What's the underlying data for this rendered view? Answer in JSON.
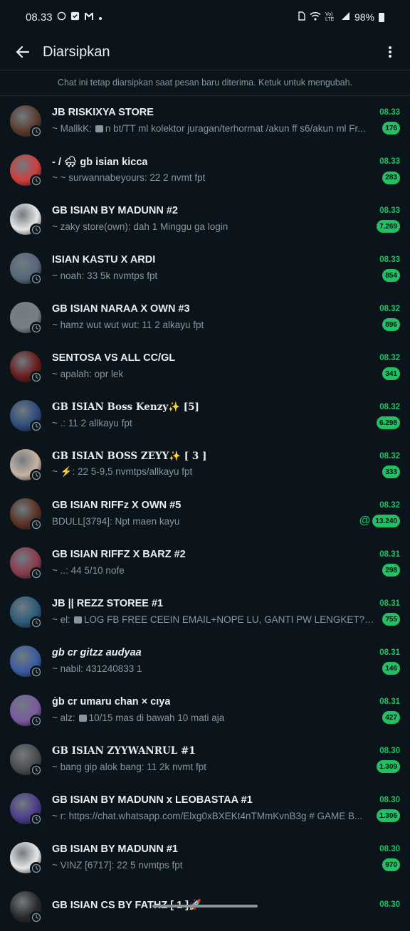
{
  "status_bar": {
    "time": "08.33",
    "battery": "98%",
    "network": "Vo) LTE"
  },
  "app_bar": {
    "title": "Diarsipkan"
  },
  "notice": "Chat ini tetap diarsipkan saat pesan baru diterima. Ketuk untuk mengubah.",
  "colors": {
    "background": "#0b141a",
    "accent": "#21c063",
    "secondary_text": "#8696a0"
  },
  "chats": [
    {
      "name": "JB RISKIXYA STORE",
      "time": "08.33",
      "preview": "~ MallkK:",
      "has_media": true,
      "media_text": "n bt/TT ml kolektor juragan/terhormat /akun ff s6/akun ml Fr...",
      "unread": "176",
      "style": "",
      "avatar": "#5a3a2a"
    },
    {
      "name": "- / 🌨 gb isian kicca",
      "time": "08.33",
      "preview": "~ ~ surwannabeyours: 22 2 nvmt fpt",
      "has_media": false,
      "media_text": "",
      "unread": "283",
      "style": "",
      "avatar": "#d23b3b"
    },
    {
      "name": "GB ISIAN BY MADUNN #2",
      "time": "08.33",
      "preview": "~ zaky store(own): dah 1 Minggu ga login",
      "has_media": false,
      "media_text": "",
      "unread": "7.269",
      "style": "",
      "avatar": "#e6e6e6"
    },
    {
      "name": "ISIAN KASTU X ARDI",
      "time": "08.33",
      "preview": "~ noah: 33 5k nvmtps fpt",
      "has_media": false,
      "media_text": "",
      "unread": "854",
      "style": "",
      "avatar": "#55657a"
    },
    {
      "name": "GB ISIAN NARAA X OWN #3",
      "time": "08.32",
      "preview": "~ hamz wut wut wut: 11 2 alkayu fpt",
      "has_media": false,
      "media_text": "",
      "unread": "896",
      "style": "",
      "avatar": "#7a7f84"
    },
    {
      "name": "SENTOSA VS ALL CC/GL",
      "time": "08.32",
      "preview": "~ apalah: opr lek",
      "has_media": false,
      "media_text": "",
      "unread": "341",
      "style": "",
      "avatar": "#6a1a1a"
    },
    {
      "name": "GB ISIAN Boss Kenzy✨ [5]",
      "time": "08.32",
      "preview": "~ .: 11 2 allkayu fpt",
      "has_media": false,
      "media_text": "",
      "unread": "6.298",
      "style": "serif",
      "avatar": "#2d4a7a"
    },
    {
      "name": "GB ISIAN BOSS ZEYY✨ [ 3 ]",
      "time": "08.32",
      "preview": "~ ⚡: 22 5-9,5 nvmtps/allkayu fpt",
      "has_media": false,
      "media_text": "",
      "unread": "333",
      "style": "serif",
      "avatar": "#c9b3a3"
    },
    {
      "name": "GB ISIAN RIFFz X OWN #5",
      "time": "08.32",
      "preview": "BDULL[3794]: Npt maen kayu",
      "has_media": false,
      "media_text": "",
      "unread": "13.240",
      "mention": "@",
      "style": "",
      "avatar": "#5a3020"
    },
    {
      "name": "GB ISIAN RIFFZ X BARZ #2",
      "time": "08.31",
      "preview": "~ ..: 44 5/10 nofe",
      "has_media": false,
      "media_text": "",
      "unread": "298",
      "style": "",
      "avatar": "#8a3a4a"
    },
    {
      "name": "JB || REZZ STOREE #1",
      "time": "08.31",
      "preview": "~ el:",
      "has_media": true,
      "media_text": "LOG FB FREE CEEIN EMAIL+NOPE LU, GANTI PW LENGKET? DELA...",
      "unread": "755",
      "style": "",
      "avatar": "#2a5a7a"
    },
    {
      "name": "gb cr gitzz audyaa",
      "time": "08.31",
      "preview": "~ nabil: 431240833 1",
      "has_media": false,
      "media_text": "",
      "unread": "146",
      "style": "italic",
      "avatar": "#3a5aa0"
    },
    {
      "name": "ġb cr umaru chan × cıya",
      "time": "08.31",
      "preview": "~ alz:",
      "has_media": true,
      "media_text": "10/15 mas di bawah 10 mati aja",
      "unread": "427",
      "style": "",
      "avatar": "#7a5aa0"
    },
    {
      "name": "GB ISIAN ZYYWANRUL #1",
      "time": "08.30",
      "preview": "~ bang gip alok bang: 11 2k nvmt fpt",
      "has_media": false,
      "media_text": "",
      "unread": "1.309",
      "style": "serif",
      "avatar": "#4a4a4a"
    },
    {
      "name": "GB ISIAN BY MADUNN x LEOBASTAA #1",
      "time": "08.30",
      "preview": "~ r: https://chat.whatsapp.com/Elxg0xBXEKt4nTMmKvnB3g  # GAME B...",
      "has_media": false,
      "media_text": "",
      "unread": "1.306",
      "style": "",
      "avatar": "#4a3a8a"
    },
    {
      "name": "GB ISIAN BY MADUNN #1",
      "time": "08.30",
      "preview": "~ VINZ [6717]: 22 5 nvmtps fpt",
      "has_media": false,
      "media_text": "",
      "unread": "970",
      "style": "",
      "avatar": "#e6e6e6"
    },
    {
      "name": "GB ISIAN CS BY FATHZ [ 1 ]🚀",
      "time": "08.30",
      "preview": "",
      "has_media": false,
      "media_text": "",
      "unread": "",
      "style": "",
      "avatar": "#2a2a2a"
    }
  ]
}
